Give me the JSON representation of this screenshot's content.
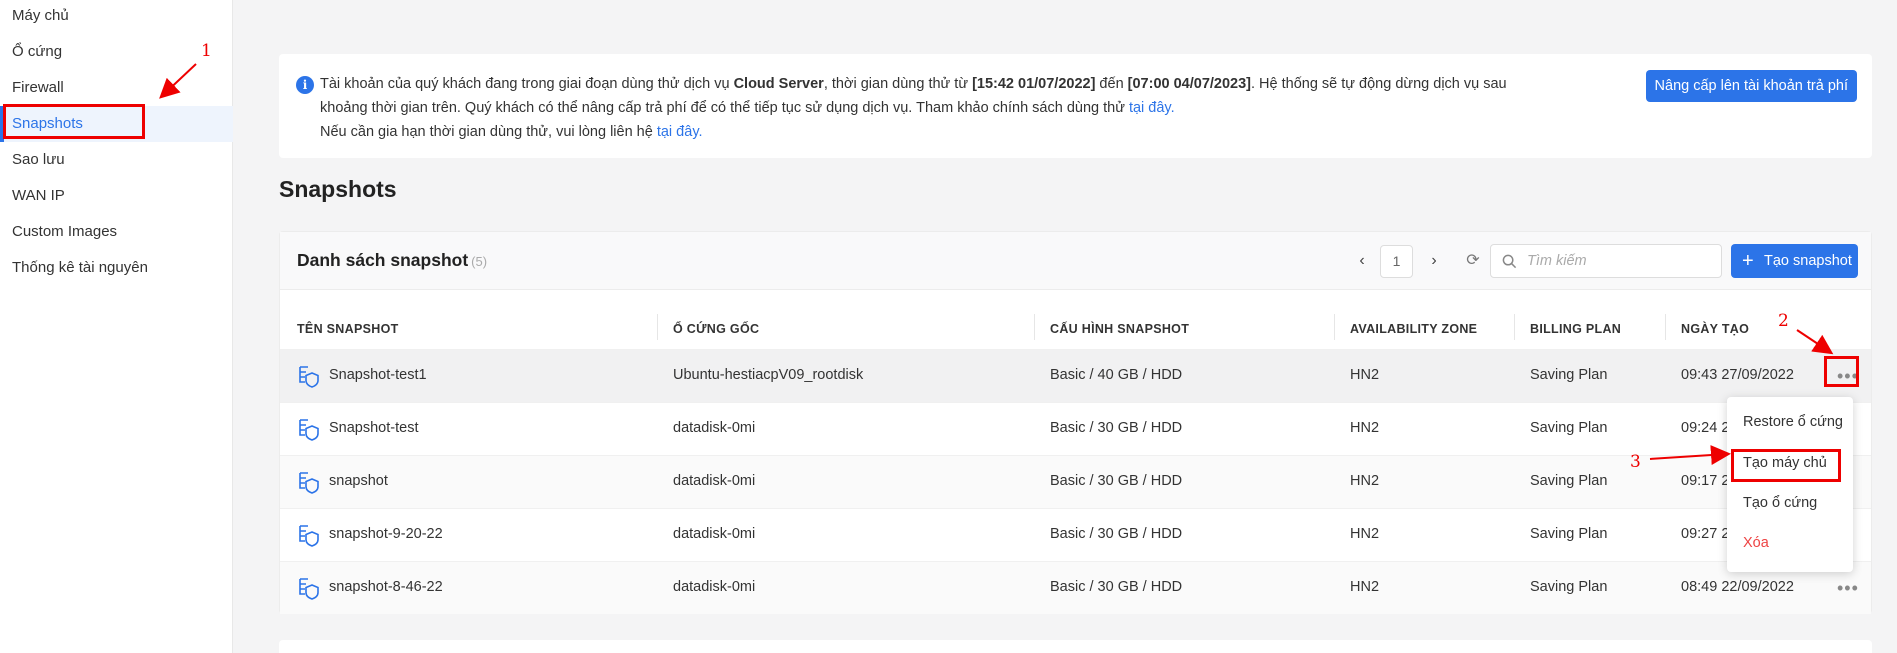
{
  "sidebar": {
    "items": [
      {
        "label": "Máy chủ"
      },
      {
        "label": "Ổ cứng"
      },
      {
        "label": "Firewall"
      },
      {
        "label": "Snapshots"
      },
      {
        "label": "Sao lưu"
      },
      {
        "label": "WAN IP"
      },
      {
        "label": "Custom Images"
      },
      {
        "label": "Thống kê tài nguyên"
      }
    ]
  },
  "notice": {
    "t1": "Tài khoản của quý khách đang trong giai đoạn dùng thử dịch vụ ",
    "service": "Cloud Server",
    "t2": ", thời gian dùng thử từ ",
    "start": "[15:42 01/07/2022]",
    "t3": " đến ",
    "end": "[07:00 04/07/2023]",
    "t4": ". Hệ thống sẽ tự động dừng dịch vụ sau khoảng thời gian trên. Quý khách có thể nâng cấp trả phí để có thể tiếp tục sử dụng dịch vụ. Tham khảo chính sách dùng thử ",
    "link1": "tại đây.",
    "t5": "Nếu cần gia hạn thời gian dùng thử, vui lòng liên hệ ",
    "link2": "tại đây.",
    "upgrade_label": "Nâng cấp lên tài khoản trả phí"
  },
  "page_title": "Snapshots",
  "panel": {
    "title": "Danh sách snapshot",
    "count": "(5)",
    "page": "1",
    "search_placeholder": "Tìm kiếm",
    "create_label": "Tạo snapshot"
  },
  "table": {
    "headers": [
      "TÊN SNAPSHOT",
      "Ổ CỨNG GỐC",
      "CẤU HÌNH SNAPSHOT",
      "AVAILABILITY ZONE",
      "BILLING PLAN",
      "NGÀY TẠO"
    ],
    "rows": [
      {
        "name": "Snapshot-test1",
        "disk": "Ubuntu-hestiacpV09_rootdisk",
        "config": "Basic / 40 GB / HDD",
        "zone": "HN2",
        "plan": "Saving Plan",
        "date": "09:43 27/09/2022"
      },
      {
        "name": "Snapshot-test",
        "disk": "datadisk-0mi",
        "config": "Basic / 30 GB / HDD",
        "zone": "HN2",
        "plan": "Saving Plan",
        "date": "09:24 2"
      },
      {
        "name": "snapshot",
        "disk": "datadisk-0mi",
        "config": "Basic / 30 GB / HDD",
        "zone": "HN2",
        "plan": "Saving Plan",
        "date": "09:17 2"
      },
      {
        "name": "snapshot-9-20-22",
        "disk": "datadisk-0mi",
        "config": "Basic / 30 GB / HDD",
        "zone": "HN2",
        "plan": "Saving Plan",
        "date": "09:27 2"
      },
      {
        "name": "snapshot-8-46-22",
        "disk": "datadisk-0mi",
        "config": "Basic / 30 GB / HDD",
        "zone": "HN2",
        "plan": "Saving Plan",
        "date": "08:49 22/09/2022"
      }
    ]
  },
  "menu": {
    "items": [
      "Restore ổ cứng",
      "Tạo máy chủ",
      "Tạo ổ cứng",
      "Xóa"
    ]
  },
  "annotations": {
    "n1": "1",
    "n2": "2",
    "n3": "3"
  },
  "colors": {
    "accent": "#2c74e8",
    "annotation": "#e00000",
    "danger": "#e44444"
  }
}
